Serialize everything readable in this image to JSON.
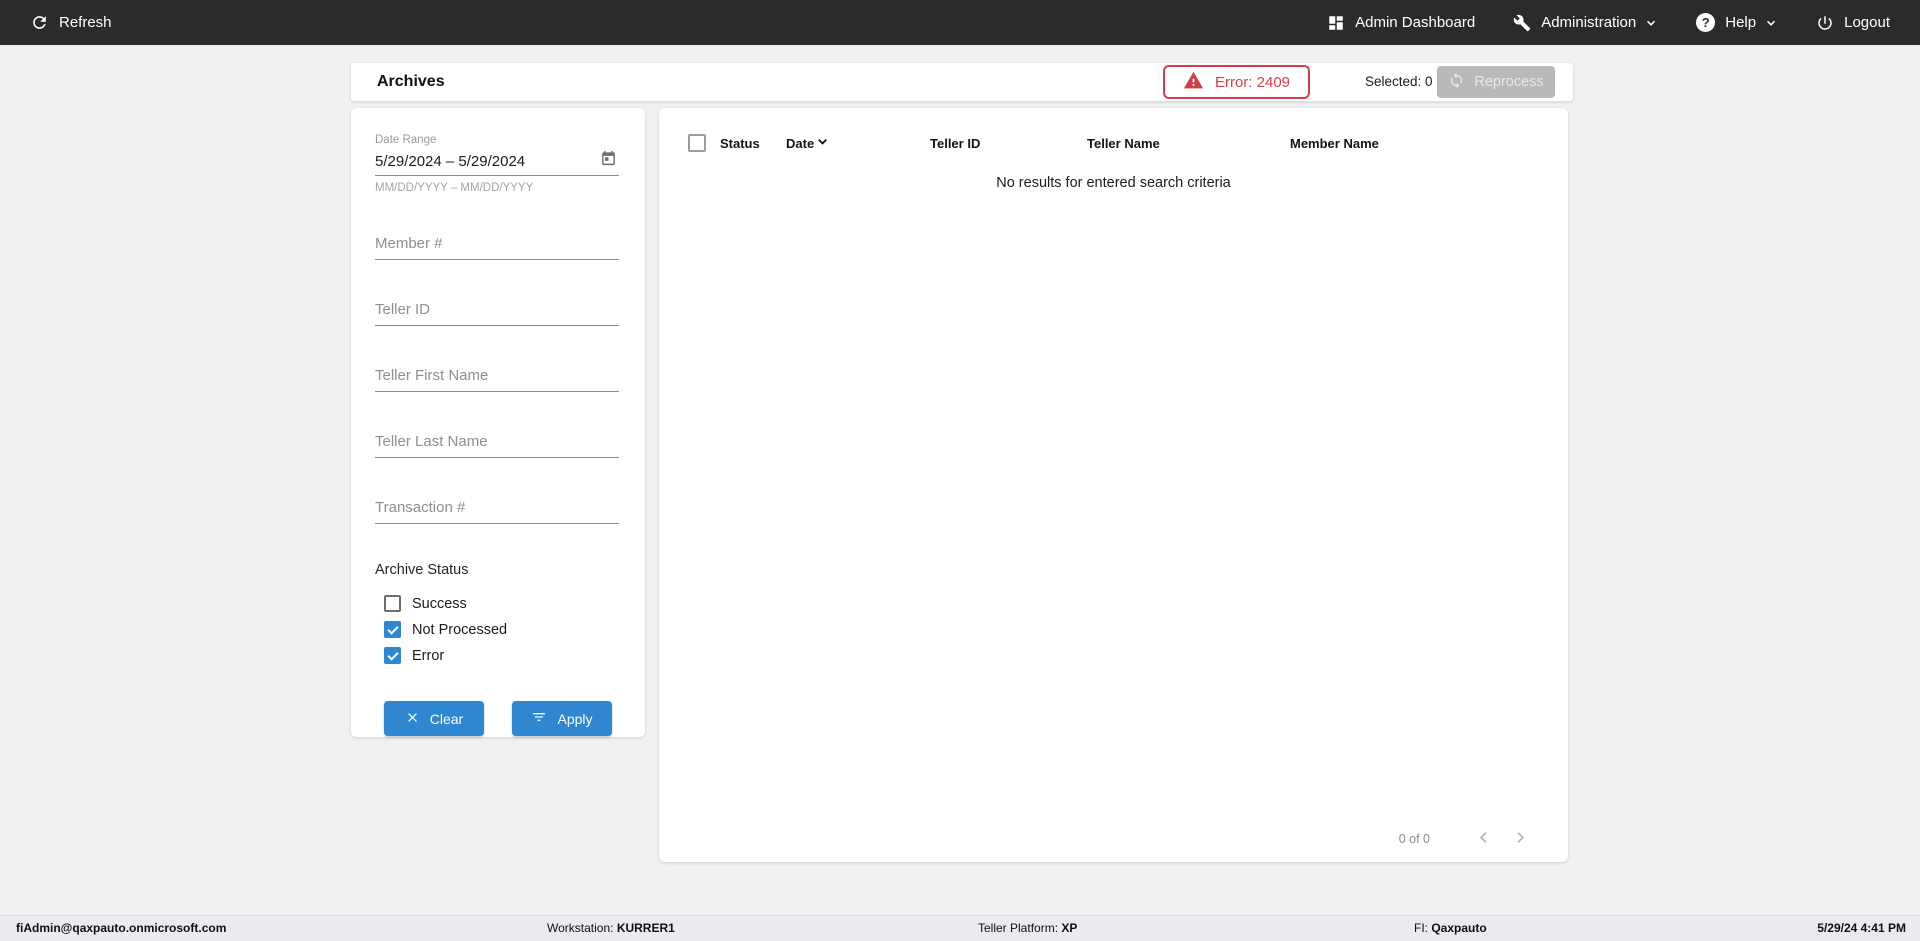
{
  "topbar": {
    "refresh": "Refresh",
    "admin_dashboard": "Admin Dashboard",
    "administration": "Administration",
    "help": "Help",
    "logout": "Logout"
  },
  "header": {
    "title": "Archives",
    "error_badge": "Error: 2409",
    "selected": "Selected: 0",
    "reprocess": "Reprocess"
  },
  "filters": {
    "date_range": {
      "label": "Date Range",
      "value": "5/29/2024 – 5/29/2024",
      "helper": "MM/DD/YYYY – MM/DD/YYYY"
    },
    "fields": [
      "Member #",
      "Teller ID",
      "Teller First Name",
      "Teller Last Name",
      "Transaction #"
    ],
    "archive_status": {
      "label": "Archive Status",
      "options": [
        {
          "label": "Success",
          "checked": false
        },
        {
          "label": "Not Processed",
          "checked": true
        },
        {
          "label": "Error",
          "checked": true
        }
      ]
    },
    "clear": "Clear",
    "apply": "Apply"
  },
  "table": {
    "columns": [
      "Status",
      "Date",
      "Teller ID",
      "Teller Name",
      "Member Name"
    ],
    "empty_message": "No results for entered search criteria",
    "pagination": "0 of 0"
  },
  "footer": {
    "user": "fiAdmin@qaxpauto.onmicrosoft.com",
    "workstation_label": "Workstation:",
    "workstation": "KURRER1",
    "platform_label": "Teller Platform:",
    "platform": "XP",
    "fi_label": "FI:",
    "fi": "Qaxpauto",
    "datetime": "5/29/24 4:41 PM"
  },
  "colors": {
    "topbar_bg": "#2b2b2b",
    "accent_blue": "#2e87d0",
    "error_red": "#d33f49",
    "disabled_button_bg": "#b9b9b9",
    "page_bg": "#f1f1f2"
  }
}
